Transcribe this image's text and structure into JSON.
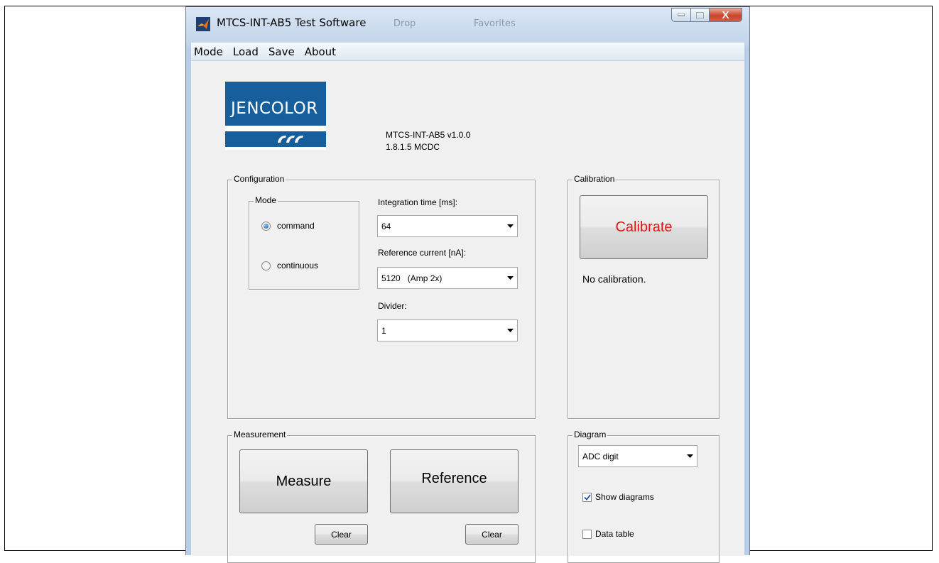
{
  "window": {
    "title": "MTCS-INT-AB5 Test Software",
    "background_hint_1": "Drop",
    "background_hint_2": "Favorites",
    "close_glyph": "X"
  },
  "menu": {
    "items": [
      "Mode",
      "Load",
      "Save",
      "About"
    ]
  },
  "logo": {
    "text": "JENCOLOR"
  },
  "version": {
    "line1": "MTCS-INT-AB5 v1.0.0",
    "line2": "1.8.1.5 MCDC"
  },
  "configuration": {
    "title": "Configuration",
    "mode": {
      "title": "Mode",
      "options": [
        "command",
        "continuous"
      ],
      "selected": "command"
    },
    "integration_time": {
      "label": "Integration time [ms]:",
      "value": "64"
    },
    "reference_current": {
      "label": "Reference current [nA]:",
      "value": "5120   (Amp 2x)"
    },
    "divider": {
      "label": "Divider:",
      "value": "1"
    }
  },
  "calibration": {
    "title": "Calibration",
    "button_label": "Calibrate",
    "status": "No calibration.",
    "accent_color": "#e21212"
  },
  "measurement": {
    "title": "Measurement",
    "measure_label": "Measure",
    "reference_label": "Reference",
    "clear_label": "Clear"
  },
  "diagram": {
    "title": "Diagram",
    "type_value": "ADC digit",
    "show_diagrams_label": "Show diagrams",
    "show_diagrams_checked": true,
    "data_table_label": "Data table",
    "data_table_checked": false
  }
}
